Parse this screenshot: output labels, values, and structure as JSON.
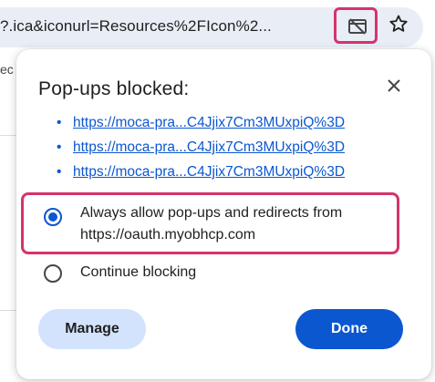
{
  "address_bar": {
    "url_fragment": "?.ica&iconurl=Resources%2FIcon%2...",
    "popup_icon": "popup-blocked-icon",
    "bookmark_icon": "star-icon"
  },
  "background": {
    "fragment": "ec"
  },
  "popup": {
    "title": "Pop-ups blocked:",
    "close_icon": "close-icon",
    "links": [
      {
        "bullet": "•",
        "text": "https://moca-pra...C4Jjix7Cm3MUxpiQ%3D"
      },
      {
        "bullet": "•",
        "text": "https://moca-pra...C4Jjix7Cm3MUxpiQ%3D"
      },
      {
        "bullet": "•",
        "text": "https://moca-pra...C4Jjix7Cm3MUxpiQ%3D"
      }
    ],
    "options": {
      "allow_line1": "Always allow pop-ups and redirects from",
      "allow_line2": "https://oauth.myobhcp.com",
      "block": "Continue blocking",
      "selected": "allow"
    },
    "buttons": {
      "manage": "Manage",
      "done": "Done"
    }
  },
  "colors": {
    "accent": "#0b57d0",
    "highlight": "#d6336c",
    "manage_bg": "#d3e3fd"
  }
}
